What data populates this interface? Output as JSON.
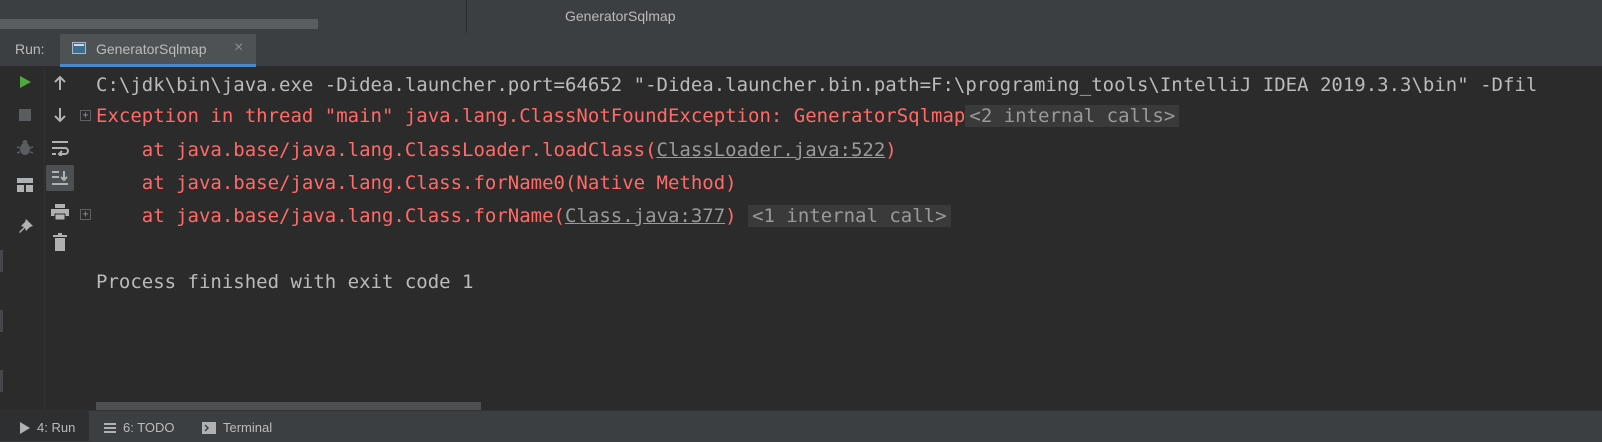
{
  "top": {
    "title": "GeneratorSqlmap"
  },
  "run_panel": {
    "label": "Run:",
    "tab": {
      "label": "GeneratorSqlmap",
      "close": "×"
    }
  },
  "toolbar_icons": [
    "rerun-icon",
    "stop-icon",
    "bug-icon",
    "layout-icon",
    "pin-icon",
    "up-arrow-icon",
    "down-arrow-icon",
    "soft-wrap-icon",
    "scroll-to-end-icon",
    "print-icon",
    "trash-icon"
  ],
  "console": {
    "command": "C:\\jdk\\bin\\java.exe -Didea.launcher.port=64652 \"-Didea.launcher.bin.path=F:\\programing_tools\\IntelliJ IDEA 2019.3.3\\bin\" -Dfil",
    "exception": "Exception in thread \"main\" java.lang.ClassNotFoundException: GeneratorSqlmap",
    "exception_internal": "<2 internal calls>",
    "stack": [
      {
        "prefix": "    at java.base/java.lang.ClassLoader.loadClass(",
        "link": "ClassLoader.java:522",
        "suffix": ")"
      },
      {
        "prefix": "    at java.base/java.lang.Class.forName0(Native Method)",
        "link": "",
        "suffix": ""
      },
      {
        "prefix": "    at java.base/java.lang.Class.forName(",
        "link": "Class.java:377",
        "suffix": ")",
        "internal": "<1 internal call>"
      }
    ],
    "exit": "Process finished with exit code 1"
  },
  "bottom_tabs": [
    {
      "label": "4: Run",
      "icon": "play-icon"
    },
    {
      "label": "6: TODO",
      "icon": "todo-icon"
    },
    {
      "label": "Terminal",
      "icon": "terminal-icon"
    }
  ],
  "colors": {
    "background": "#2b2b2b",
    "panel": "#3c3f41",
    "error": "#ff6b68",
    "text": "#bbbbbb",
    "accent": "#4a88c7"
  }
}
